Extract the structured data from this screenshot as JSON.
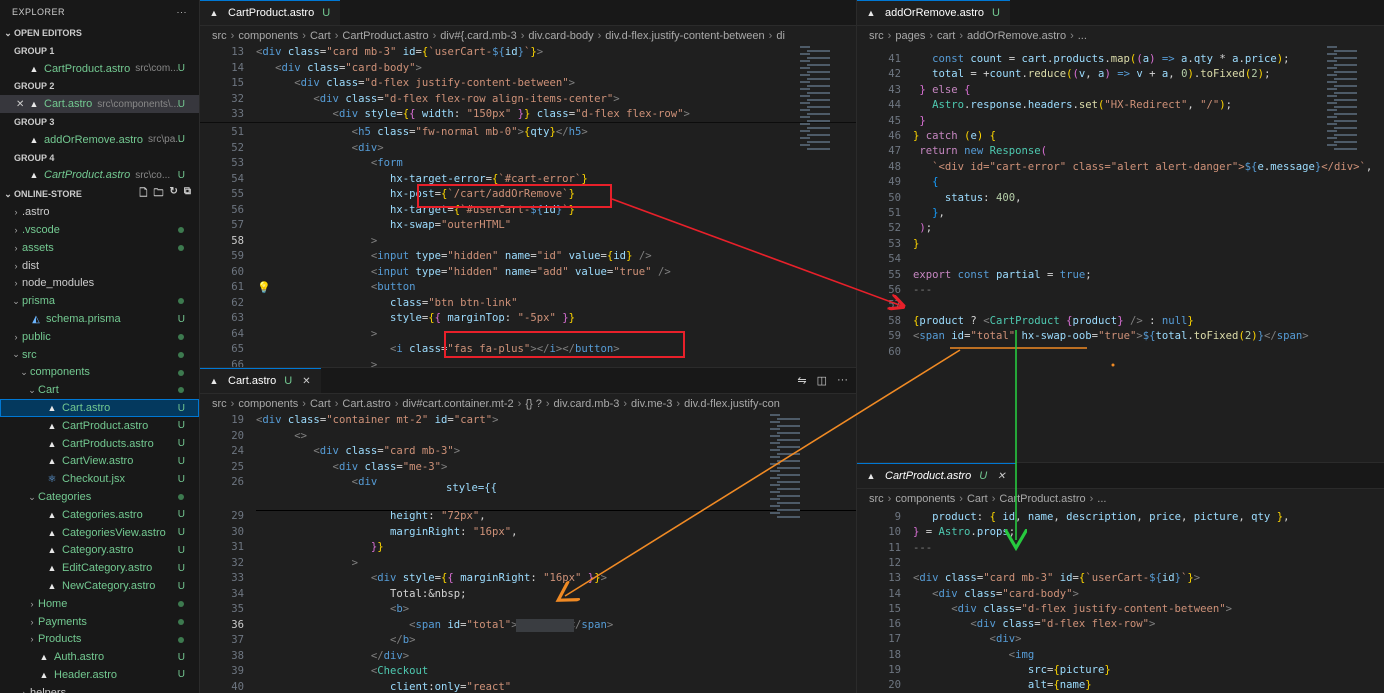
{
  "explorer": {
    "title": "EXPLORER",
    "more": "···",
    "open_editors": "OPEN EDITORS",
    "groups": [
      {
        "label": "GROUP 1",
        "file": "CartProduct.astro",
        "path": "src\\com...",
        "badge": "U"
      },
      {
        "label": "GROUP 2",
        "file": "Cart.astro",
        "path": "src\\components\\...",
        "badge": "U"
      },
      {
        "label": "GROUP 3",
        "file": "addOrRemove.astro",
        "path": "src\\pa...",
        "badge": "U"
      },
      {
        "label": "GROUP 4",
        "file": "CartProduct.astro",
        "path": "src\\co...",
        "badge": "U"
      }
    ],
    "project": "ONLINE-STORE",
    "tree": [
      {
        "name": ".astro",
        "kind": "folder"
      },
      {
        "name": ".vscode",
        "kind": "folder",
        "dot": true
      },
      {
        "name": "assets",
        "kind": "folder",
        "dot": true
      },
      {
        "name": "dist",
        "kind": "folder"
      },
      {
        "name": "node_modules",
        "kind": "folder"
      },
      {
        "name": "prisma",
        "kind": "folder-open",
        "dot": true
      },
      {
        "name": "schema.prisma",
        "kind": "file",
        "badge": "U"
      },
      {
        "name": "public",
        "kind": "folder",
        "dot": true
      },
      {
        "name": "src",
        "kind": "folder-open",
        "dot": true
      },
      {
        "name": "components",
        "kind": "folder-open",
        "dot": true
      },
      {
        "name": "Cart",
        "kind": "folder-open",
        "dot": true
      },
      {
        "name": "Cart.astro",
        "kind": "astro",
        "badge": "U",
        "selected": true
      },
      {
        "name": "CartProduct.astro",
        "kind": "astro",
        "badge": "U"
      },
      {
        "name": "CartProducts.astro",
        "kind": "astro",
        "badge": "U"
      },
      {
        "name": "CartView.astro",
        "kind": "astro",
        "badge": "U"
      },
      {
        "name": "Checkout.jsx",
        "kind": "jsx",
        "badge": "U"
      },
      {
        "name": "Categories",
        "kind": "folder-open",
        "dot": true
      },
      {
        "name": "Categories.astro",
        "kind": "astro",
        "badge": "U"
      },
      {
        "name": "CategoriesView.astro",
        "kind": "astro",
        "badge": "U"
      },
      {
        "name": "Category.astro",
        "kind": "astro",
        "badge": "U"
      },
      {
        "name": "EditCategory.astro",
        "kind": "astro",
        "badge": "U"
      },
      {
        "name": "NewCategory.astro",
        "kind": "astro",
        "badge": "U"
      },
      {
        "name": "Home",
        "kind": "folder",
        "dot": true
      },
      {
        "name": "Payments",
        "kind": "folder",
        "dot": true
      },
      {
        "name": "Products",
        "kind": "folder",
        "dot": true
      },
      {
        "name": "Auth.astro",
        "kind": "astro",
        "badge": "U"
      },
      {
        "name": "Header.astro",
        "kind": "astro",
        "badge": "U"
      },
      {
        "name": "helpers",
        "kind": "folder"
      }
    ]
  },
  "pane_tl": {
    "tab": "CartProduct.astro",
    "tab_badge": "U",
    "crumbs": [
      "src",
      "components",
      "Cart",
      "CartProduct.astro",
      "div#{.card.mb-3",
      "div.card-body",
      "div.d-flex.justify-content-between",
      "di"
    ]
  },
  "pane_bl": {
    "tab": "Cart.astro",
    "tab_badge": "U",
    "crumbs": [
      "src",
      "components",
      "Cart",
      "Cart.astro",
      "div#cart.container.mt-2",
      "{} ?",
      "div.card.mb-3",
      "div.me-3",
      "div.d-flex.justify-con"
    ]
  },
  "pane_tr": {
    "tab": "addOrRemove.astro",
    "tab_badge": "U",
    "crumbs": [
      "src",
      "pages",
      "cart",
      "addOrRemove.astro",
      "..."
    ]
  },
  "pane_br": {
    "tab": "CartProduct.astro",
    "tab_badge": "U",
    "crumbs": [
      "src",
      "components",
      "Cart",
      "CartProduct.astro",
      "..."
    ]
  },
  "colors": {
    "annotation_red": "#e8202a",
    "annotation_orange": "#f08a24",
    "annotation_green": "#27c93f",
    "selection": "#04395e"
  }
}
